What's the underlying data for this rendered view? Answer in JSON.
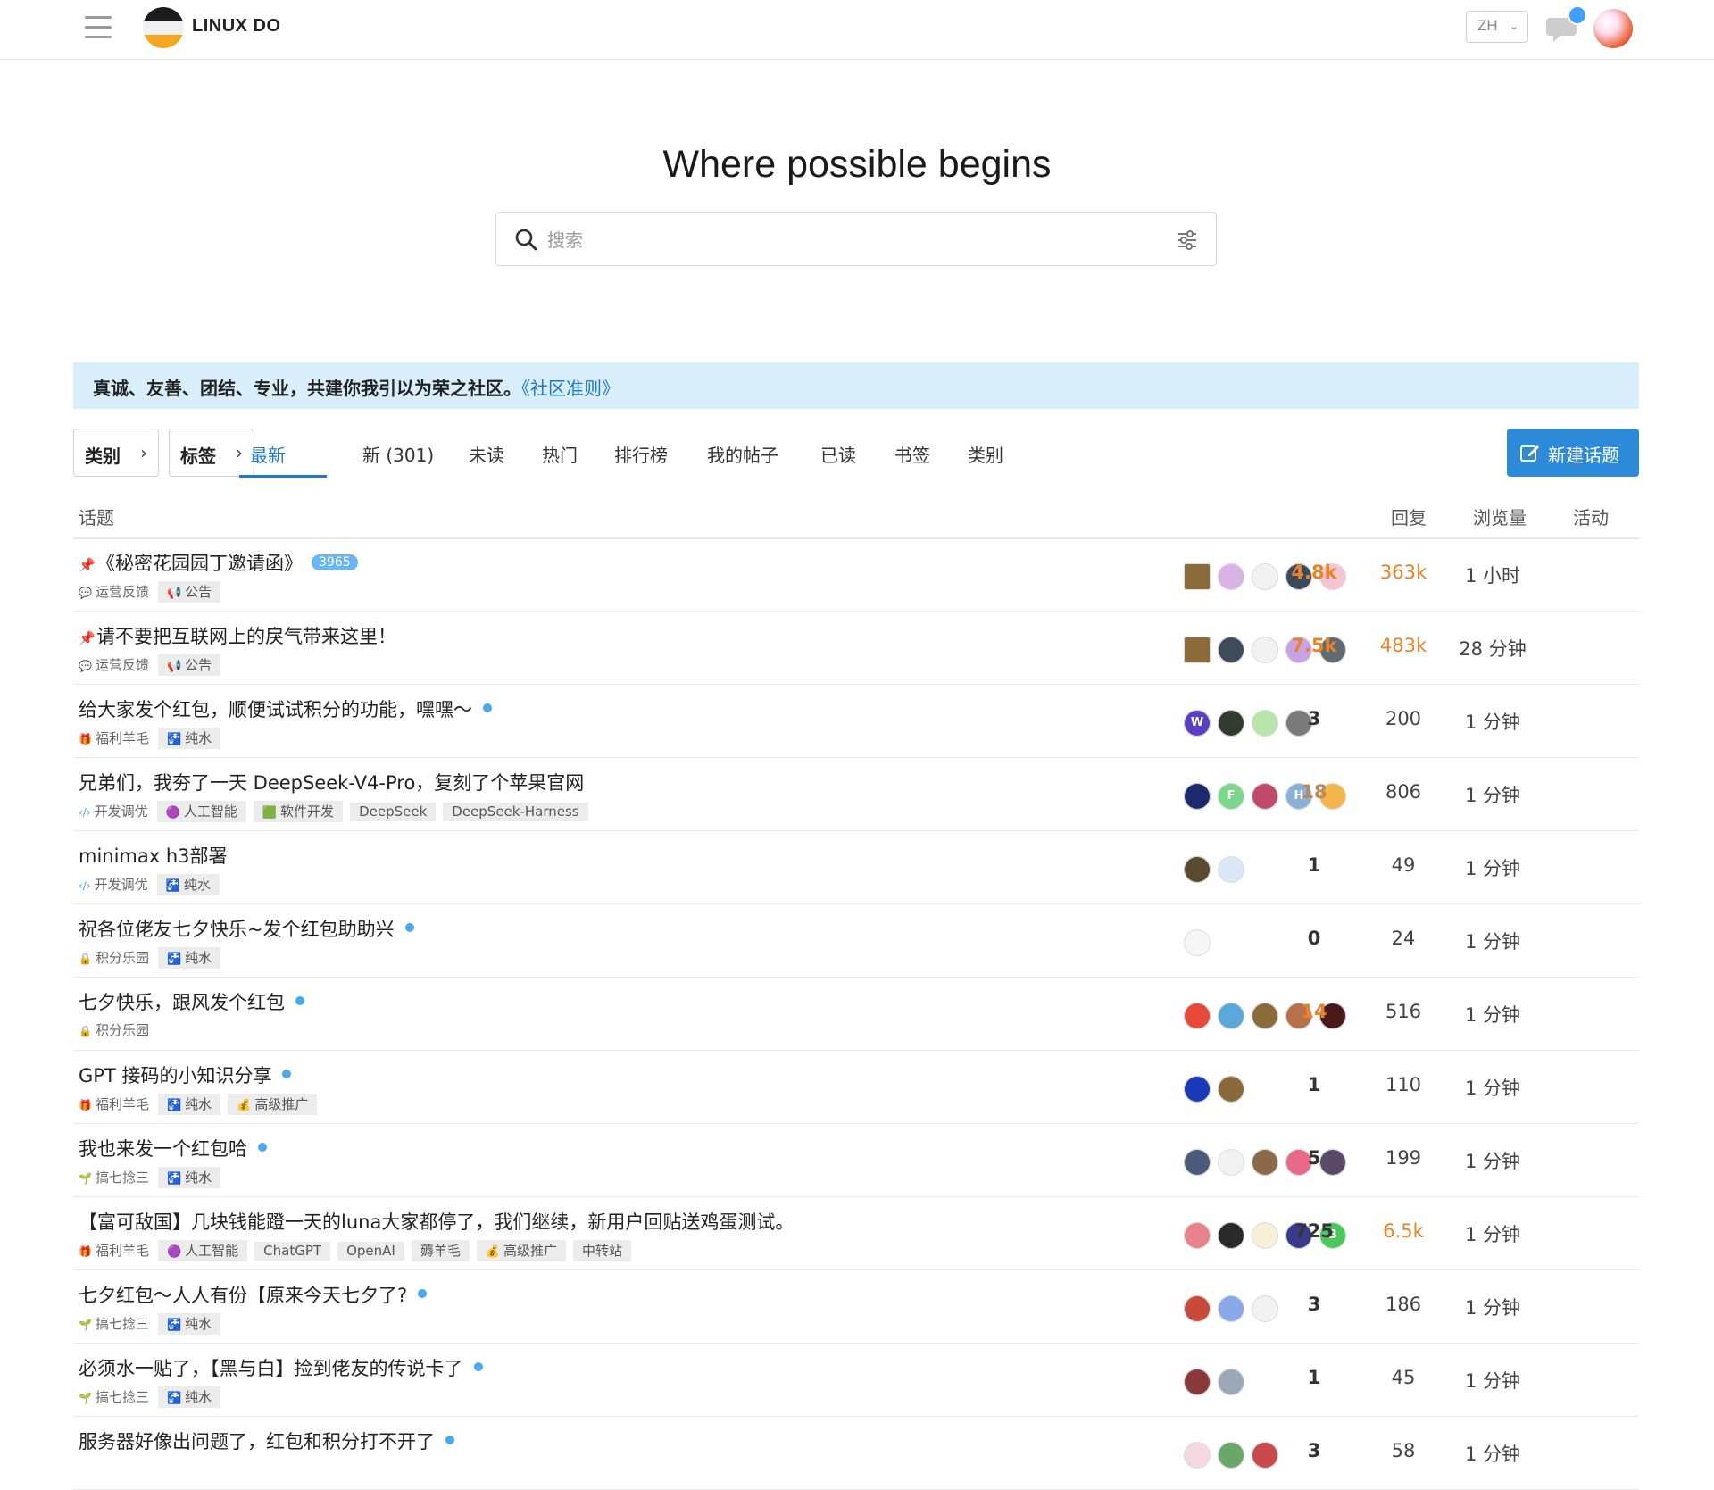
{
  "header": {
    "brand": "LINUX DO",
    "lang": "ZH"
  },
  "hero": {
    "title": "Where possible begins",
    "search_placeholder": "搜索"
  },
  "banner": {
    "text": "真诚、友善、团结、专业，共建你我引以为荣之社区。",
    "link": "《社区准则》"
  },
  "nav": {
    "category_dropdown": "类别",
    "tag_dropdown": "标签",
    "tabs": [
      "最新",
      "新 (301)",
      "未读",
      "热门",
      "排行榜",
      "我的帖子",
      "已读",
      "书签",
      "类别"
    ],
    "active_tab": "最新",
    "new_topic": "新建话题"
  },
  "table": {
    "headers": {
      "topic": "话题",
      "replies": "回复",
      "views": "浏览量",
      "activity": "活动"
    },
    "rows": [
      {
        "pinned": true,
        "title": "《秘密花园园丁邀请函》",
        "badge": "3965",
        "unread": false,
        "category": "运营反馈",
        "category_icon": "chat-icon",
        "category_color": "#8a8a8a",
        "tags": [
          {
            "label": "公告",
            "icon": "📢"
          }
        ],
        "avatars": [
          "#8b6b3a",
          "#d9b3e6",
          "#f2f2f2",
          "#3a4a5a",
          "#f6c6d0"
        ],
        "replies": "4.8k",
        "reply_style": "hot",
        "views": "363k",
        "view_style": "warm",
        "activity": "1 小时"
      },
      {
        "pinned": true,
        "title": "请不要把互联网上的戾气带来这里！",
        "badge": "",
        "unread": false,
        "category": "运营反馈",
        "category_icon": "chat-icon",
        "category_color": "#8a8a8a",
        "tags": [
          {
            "label": "公告",
            "icon": "📢"
          }
        ],
        "avatars": [
          "#8b6b3a",
          "#3d4b5c",
          "#f2f2f2",
          "#c9a2e6",
          "#606a70"
        ],
        "replies": "7.5k",
        "reply_style": "hot",
        "views": "483k",
        "view_style": "warm",
        "activity": "28 分钟"
      },
      {
        "pinned": false,
        "title": "给大家发个红包，顺便试试积分的功能，嘿嘿～",
        "badge": "",
        "unread": true,
        "category": "福利羊毛",
        "category_icon": "gift-icon",
        "category_color": "#e04b3a",
        "tags": [
          {
            "label": "纯水",
            "icon": "🚰"
          }
        ],
        "avatars": [
          "#5a3fc0",
          "#2e3b2e",
          "#b8e6a8",
          "#7a7a7a"
        ],
        "avatar_text": [
          "W",
          "",
          "",
          ""
        ],
        "replies": "3",
        "reply_style": "bold",
        "views": "200",
        "view_style": "plain",
        "activity": "1 分钟"
      },
      {
        "pinned": false,
        "title": "兄弟们，我夯了一天 DeepSeek-V4-Pro，复刻了个苹果官网",
        "badge": "",
        "unread": false,
        "category": "开发调优",
        "category_icon": "code-icon",
        "category_color": "#4aa8ec",
        "tags": [
          {
            "label": "人工智能",
            "icon": "🟣"
          },
          {
            "label": "软件开发",
            "icon": "🟩"
          },
          {
            "label": "DeepSeek",
            "icon": ""
          },
          {
            "label": "DeepSeek-Harness",
            "icon": ""
          }
        ],
        "avatars": [
          "#1a2a6c",
          "#7ad88a",
          "#c04a6a",
          "#8ab0d8",
          "#f2b64a"
        ],
        "avatar_text": [
          "",
          "F",
          "",
          "H",
          ""
        ],
        "replies": "18",
        "reply_style": "mid",
        "views": "806",
        "view_style": "plain",
        "activity": "1 分钟"
      },
      {
        "pinned": false,
        "title": "minimax h3部署",
        "badge": "",
        "unread": false,
        "category": "开发调优",
        "category_icon": "code-icon",
        "category_color": "#4aa8ec",
        "tags": [
          {
            "label": "纯水",
            "icon": "🚰"
          }
        ],
        "avatars": [
          "#5a4a30",
          "#dbe8f8"
        ],
        "replies": "1",
        "reply_style": "bold",
        "views": "49",
        "view_style": "plain",
        "activity": "1 分钟"
      },
      {
        "pinned": false,
        "title": "祝各位佬友七夕快乐~发个红包助助兴",
        "badge": "",
        "unread": true,
        "category": "积分乐园",
        "category_icon": "lock-icon",
        "category_color": "#f5c542",
        "tags": [
          {
            "label": "纯水",
            "icon": "🚰"
          }
        ],
        "avatars": [
          "#f6f6f6"
        ],
        "replies": "0",
        "reply_style": "bold",
        "views": "24",
        "view_style": "plain",
        "activity": "1 分钟"
      },
      {
        "pinned": false,
        "title": "七夕快乐，跟风发个红包",
        "badge": "",
        "unread": true,
        "category": "积分乐园",
        "category_icon": "lock-icon",
        "category_color": "#f5c542",
        "tags": [],
        "avatars": [
          "#e84a3a",
          "#5aa8d8",
          "#8b6b3a",
          "#b8704a",
          "#4a1a1a"
        ],
        "replies": "14",
        "reply_style": "hot",
        "views": "516",
        "view_style": "plain",
        "activity": "1 分钟"
      },
      {
        "pinned": false,
        "title": "GPT 接码的小知识分享",
        "badge": "",
        "unread": true,
        "category": "福利羊毛",
        "category_icon": "gift-icon",
        "category_color": "#e04b3a",
        "tags": [
          {
            "label": "纯水",
            "icon": "🚰"
          },
          {
            "label": "高级推广",
            "icon": "💰"
          }
        ],
        "avatars": [
          "#1a3ab8",
          "#8a6a3a"
        ],
        "replies": "1",
        "reply_style": "bold",
        "views": "110",
        "view_style": "plain",
        "activity": "1 分钟"
      },
      {
        "pinned": false,
        "title": "我也来发一个红包哈",
        "badge": "",
        "unread": true,
        "category": "搞七捻三",
        "category_icon": "leaf-icon",
        "category_color": "#3aa84a",
        "tags": [
          {
            "label": "纯水",
            "icon": "🚰"
          }
        ],
        "avatars": [
          "#4a5a7a",
          "#f2f2f2",
          "#8a6a4a",
          "#e86a8a",
          "#5a4a6a"
        ],
        "replies": "5",
        "reply_style": "bold",
        "views": "199",
        "view_style": "plain",
        "activity": "1 分钟"
      },
      {
        "pinned": false,
        "title": "【富可敌国】几块钱能蹬一天的luna大家都停了，我们继续，新用户回贴送鸡蛋测试。",
        "badge": "",
        "unread": false,
        "category": "福利羊毛",
        "category_icon": "gift-icon",
        "category_color": "#e04b3a",
        "tags": [
          {
            "label": "人工智能",
            "icon": "🟣"
          },
          {
            "label": "ChatGPT",
            "icon": ""
          },
          {
            "label": "OpenAI",
            "icon": ""
          },
          {
            "label": "薅羊毛",
            "icon": ""
          },
          {
            "label": "高级推广",
            "icon": "💰"
          },
          {
            "label": "中转站",
            "icon": ""
          }
        ],
        "avatars": [
          "#e8828a",
          "#2a2a2a",
          "#f6f0d8",
          "#3a3a8a",
          "#4ac85a"
        ],
        "avatar_text": [
          "",
          "",
          "",
          "",
          "B"
        ],
        "replies": "725",
        "reply_style": "bold",
        "views": "6.5k",
        "view_style": "warm",
        "activity": "1 分钟"
      },
      {
        "pinned": false,
        "title": "七夕红包～人人有份【原来今天七夕了?",
        "badge": "",
        "unread": true,
        "category": "搞七捻三",
        "category_icon": "leaf-icon",
        "category_color": "#3aa84a",
        "tags": [
          {
            "label": "纯水",
            "icon": "🚰"
          }
        ],
        "avatars": [
          "#c84a3a",
          "#8aa8e8",
          "#f2f2f2"
        ],
        "replies": "3",
        "reply_style": "bold",
        "views": "186",
        "view_style": "plain",
        "activity": "1 分钟"
      },
      {
        "pinned": false,
        "title": "必须水一贴了，【黑与白】捡到佬友的传说卡了",
        "badge": "",
        "unread": true,
        "category": "搞七捻三",
        "category_icon": "leaf-icon",
        "category_color": "#3aa84a",
        "tags": [
          {
            "label": "纯水",
            "icon": "🚰"
          }
        ],
        "avatars": [
          "#8a3a3a",
          "#9aa8b8"
        ],
        "replies": "1",
        "reply_style": "bold",
        "views": "45",
        "view_style": "plain",
        "activity": "1 分钟"
      },
      {
        "pinned": false,
        "title": "服务器好像出问题了，红包和积分打不开了",
        "badge": "",
        "unread": true,
        "category": "",
        "category_icon": "",
        "category_color": "#999",
        "tags": [],
        "avatars": [
          "#f6d8e0",
          "#6aa86a",
          "#c84a4a"
        ],
        "replies": "3",
        "reply_style": "bold",
        "views": "58",
        "view_style": "plain",
        "activity": "1 分钟"
      }
    ]
  }
}
